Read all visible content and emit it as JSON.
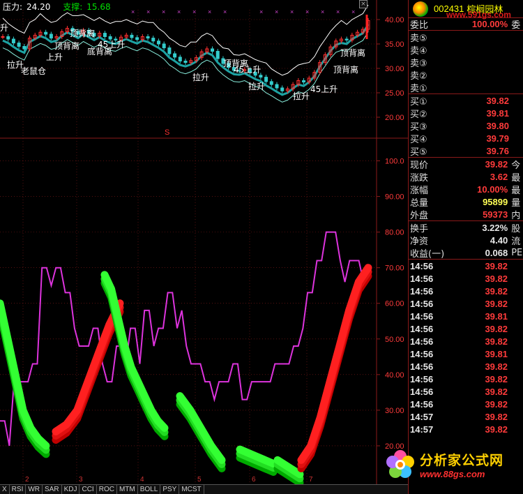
{
  "top_legend": {
    "pressure_label": "压力:",
    "pressure_value": "24.20",
    "support_label": "支撑:",
    "support_value": "15.68"
  },
  "watermark_top": "www.591gs.com",
  "header": {
    "code": "002431",
    "name": "棕榈园林"
  },
  "order_book": {
    "weibi": {
      "label": "委比",
      "value": "100.00%",
      "suffix": "委"
    },
    "sells": [
      {
        "label": "卖⑤",
        "price": "",
        "vol": ""
      },
      {
        "label": "卖④",
        "price": "",
        "vol": ""
      },
      {
        "label": "卖③",
        "price": "",
        "vol": ""
      },
      {
        "label": "卖②",
        "price": "",
        "vol": ""
      },
      {
        "label": "卖①",
        "price": "",
        "vol": ""
      }
    ],
    "buys": [
      {
        "label": "买①",
        "price": "39.82"
      },
      {
        "label": "买②",
        "price": "39.81"
      },
      {
        "label": "买③",
        "price": "39.80"
      },
      {
        "label": "买④",
        "price": "39.79"
      },
      {
        "label": "买⑤",
        "price": "39.76"
      }
    ]
  },
  "quote": [
    {
      "label": "现价",
      "value": "39.82",
      "suffix": "今",
      "color": "red"
    },
    {
      "label": "涨跌",
      "value": "3.62",
      "suffix": "最",
      "color": "red"
    },
    {
      "label": "涨幅",
      "value": "10.00%",
      "suffix": "最",
      "color": "red"
    },
    {
      "label": "总量",
      "value": "95899",
      "suffix": "量",
      "color": "yellow"
    },
    {
      "label": "外盘",
      "value": "59373",
      "suffix": "内",
      "color": "red"
    }
  ],
  "fundamentals": [
    {
      "label": "换手",
      "value": "3.22%",
      "suffix": "股"
    },
    {
      "label": "净资",
      "value": "4.40",
      "suffix": "流"
    },
    {
      "label": "收益(一)",
      "value": "0.068",
      "suffix": "PE"
    }
  ],
  "ticks": [
    {
      "time": "14:56",
      "price": "39.82"
    },
    {
      "time": "14:56",
      "price": "39.82"
    },
    {
      "time": "14:56",
      "price": "39.82"
    },
    {
      "time": "14:56",
      "price": "39.82"
    },
    {
      "time": "14:56",
      "price": "39.81"
    },
    {
      "time": "14:56",
      "price": "39.82"
    },
    {
      "time": "14:56",
      "price": "39.82"
    },
    {
      "time": "14:56",
      "price": "39.81"
    },
    {
      "time": "14:56",
      "price": "39.82"
    },
    {
      "time": "14:56",
      "price": "39.82"
    },
    {
      "time": "14:56",
      "price": "39.82"
    },
    {
      "time": "14:56",
      "price": "39.82"
    },
    {
      "time": "14:57",
      "price": "39.82"
    },
    {
      "time": "14:57",
      "price": "39.82"
    }
  ],
  "bottom_tabs": [
    "X",
    "RSI",
    "WR",
    "SAR",
    "KDJ",
    "CCI",
    "ROC",
    "MTM",
    "BOLL",
    "PSY",
    "MCST"
  ],
  "s_marker": "S",
  "watermark": {
    "title": "分析家公式网",
    "url": "www.88gs.com"
  },
  "colors": {
    "grid": "#8b1a1a",
    "up": "#ff2020",
    "down": "#00e000",
    "indicator": "#dd33dd",
    "envelope": "#ffffff",
    "ma": "#22c0c0"
  },
  "chart_data": [
    {
      "type": "candlestick",
      "title": "",
      "y_ticks": [
        "40.00",
        "35.00",
        "30.00",
        "25.00",
        "20.00"
      ],
      "ylim": [
        18,
        42
      ],
      "annotations": [
        {
          "text": "升"
        },
        {
          "text": "拉升"
        },
        {
          "text": "老鼠仓"
        },
        {
          "text": "顶背离"
        },
        {
          "text": "顶背离"
        },
        {
          "text": "上升"
        },
        {
          "text": "底背离"
        },
        {
          "text": "45上升"
        },
        {
          "text": "顶背离"
        },
        {
          "text": "45上升"
        },
        {
          "text": "拉升"
        },
        {
          "text": "拉升"
        },
        {
          "text": "拉升"
        },
        {
          "text": "45上升"
        },
        {
          "text": "顶背离"
        },
        {
          "text": "顶背离"
        }
      ],
      "x_markers_count": 14,
      "close": [
        36.5,
        36.0,
        35.2,
        34.5,
        34.0,
        36.2,
        36.8,
        37.4,
        37.0,
        36.2,
        36.5,
        37.5,
        38.2,
        37.6,
        37.0,
        37.8,
        37.2,
        36.6,
        37.2,
        36.5,
        36.0,
        35.8,
        36.4,
        36.8,
        36.3,
        35.9,
        36.5,
        36.2,
        35.6,
        35.0,
        34.2,
        33.0,
        32.3,
        31.5,
        31.2,
        31.6,
        32.2,
        33.4,
        34.0,
        33.5,
        32.0,
        31.0,
        30.2,
        29.6,
        29.5,
        29.8,
        29.2,
        28.6,
        28.2,
        27.3,
        26.7,
        26.0,
        25.4,
        25.8,
        26.7,
        27.5,
        27.2,
        28.0,
        29.2,
        31.2,
        32.8,
        34.4,
        35.6,
        36.0,
        35.8,
        36.8,
        37.4,
        38.0,
        39.8
      ]
    },
    {
      "type": "line",
      "title": "",
      "y_ticks": [
        "100.0",
        "90.00",
        "80.00",
        "70.00",
        "60.00",
        "50.00",
        "40.00",
        "30.00",
        "20.00"
      ],
      "ylim": [
        10,
        105
      ],
      "series": [
        {
          "values": [
            27,
            27,
            20,
            38,
            38,
            38,
            38,
            43,
            43,
            70,
            70,
            65,
            70,
            70,
            63,
            63,
            53,
            48,
            48,
            48,
            53,
            53,
            43,
            38,
            38,
            48,
            48,
            43,
            53,
            53,
            43,
            58,
            58,
            48,
            53,
            53,
            63,
            63,
            53,
            58,
            48,
            43,
            43,
            43,
            38,
            38,
            33,
            38,
            38,
            38,
            43,
            43,
            33,
            33,
            38,
            38,
            38,
            38,
            38,
            43,
            43,
            43,
            43,
            48,
            48,
            53,
            63,
            63,
            72,
            72,
            80,
            80,
            80,
            72,
            66,
            72,
            72,
            72,
            66,
            66
          ]
        }
      ],
      "ribbons": [
        {
          "color": "green",
          "values": [
            60,
            50,
            40,
            30,
            25,
            22,
            20
          ]
        },
        {
          "color": "red",
          "values": [
            24,
            26,
            30,
            38,
            46,
            54,
            60
          ]
        },
        {
          "color": "green",
          "values": [
            68,
            64,
            56,
            48,
            42,
            38,
            34,
            30,
            27,
            25
          ]
        },
        {
          "color": "green",
          "values": [
            34,
            30,
            25,
            20,
            16
          ]
        },
        {
          "color": "green",
          "values": [
            19,
            18,
            17,
            16,
            15
          ]
        },
        {
          "color": "green",
          "values": [
            16,
            14,
            12
          ]
        },
        {
          "color": "red",
          "values": [
            16,
            20,
            28,
            38,
            48,
            58,
            66,
            70
          ]
        }
      ]
    }
  ]
}
